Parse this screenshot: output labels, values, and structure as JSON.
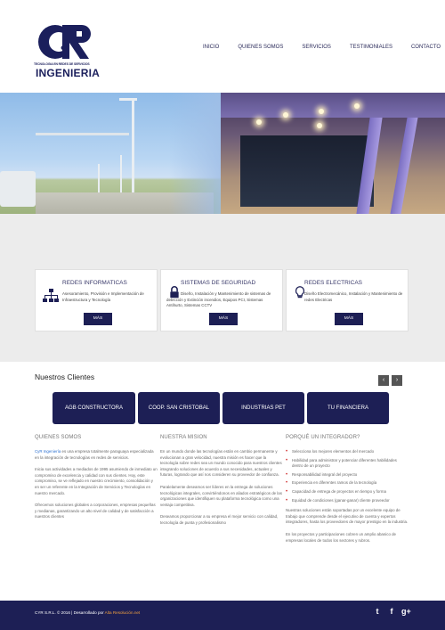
{
  "header": {
    "logo": {
      "tagline": "TECNOLOGIA EN REDES DE SERVICIOS",
      "brand": "INGENIERIA"
    },
    "nav": [
      "INICIO",
      "QUIENES SOMOS",
      "SERVICIOS",
      "TESTIMONIALES",
      "CONTACTO"
    ]
  },
  "services": [
    {
      "title": "REDES INFORMATICAS",
      "icon": "network-icon",
      "desc": "Asesoramiento, Provisión e Implementación de Infraestructura y Tecnología",
      "button": "MÁS"
    },
    {
      "title": "SISTEMAS DE SEGURIDAD",
      "icon": "lock-icon",
      "desc": "Diseño, Instalación y Mantenimiento de sistemas de detección y Extinción incendios, Equipos PCI, Sistemas Antihurto, Sistemas CCTV",
      "button": "MÁS"
    },
    {
      "title": "REDES ELECTRICAS",
      "icon": "lightbulb-icon",
      "desc": "Diseño Electromecánico, Instalación y Mantenimiento de redes Electricas",
      "button": "MÁS"
    }
  ],
  "clients": {
    "title": "Nuestros Clientes",
    "prev": "‹",
    "next": "›",
    "items": [
      "AGB CONSTRUCTORA",
      "COOP. SAN CRISTOBAL",
      "INDUSTRIAS PET",
      "TU FINANCIERA"
    ]
  },
  "about": {
    "title": "QUIENES SOMOS",
    "link_text": "CyR Ingeniería",
    "p1_rest": " es una empresa totalmente paraguaya especializada en la integración de tecnologías en redes de servicios.",
    "p2": "Inicia sus actividades a mediados de 1995 asumiendo de inmediato un compromiso de excelencia y calidad con sus clientes. Hoy, este compromiso, se ve reflejado en nuestro crecimiento, consolidación y en ser un referente en la Integración de Servicios y Tecnologías en nuestro mercado.",
    "p3": "Ofrecemos soluciones globales a corporaciones, empresas pequeñas y medianas, garantizando un alto nivel de calidad y de satisfacción a nuestros clientes"
  },
  "mission": {
    "title": "NUESTRA MISION",
    "p1": "En un mundo donde las tecnologías están en cambio permanente y evolucionan a gran velocidad, nuestra misión es hacer que la tecnología sobre redes sea un mundo conocido para nuestros clientes integrando soluciones de acuerdo a sus necesidades, actuales y futuras, logrando que así nos consideren su proveedor de confianza.",
    "p2": "Paralelamente deseamos ser líderes en la entrega de soluciones tecnológicas integrales, convirtiéndonos en aliados estratégicos de las organizaciones que identifiquen su plataforma tecnológica como una ventaja competitiva.",
    "p3": "Deseamos proporcionar a su empresa el mejor servicio con calidad, tecnología de punta y profesionalismo"
  },
  "why": {
    "title": "PORQUÉ UN INTEGRADOR?",
    "items": [
      "Selecciona los mejores elementos del mercado",
      "Habilidad para administrar y potenciar diferentes habilidades dentro de un proyecto",
      "Responsabilidad integral del proyecto",
      "Experiencia en diferentes ramos de la tecnología",
      "Capacidad de entrega de proyectos en tiempo y forma",
      "Equidad de condiciones (ganar-ganar) cliente proveedor"
    ],
    "p1": "Nuestras soluciones están soportadas por un excelente equipo de trabajo que comprende desde el ejecutivo de cuenta y expertos integradores, hasta los proveedores de mayor prestigio en la industria.",
    "p2": "En los proyectos y participaciones cobren un amplio abanico de empresas locales de todos los sectores y rubros."
  },
  "footer": {
    "copy": "CYR S.R.L. © 2016 | Desarrollado por ",
    "dev_link": "Alta Resolución.net",
    "social": [
      {
        "name": "twitter-icon",
        "glyph": "t"
      },
      {
        "name": "facebook-icon",
        "glyph": "f"
      },
      {
        "name": "google-plus-icon",
        "glyph": "g+"
      }
    ]
  },
  "colors": {
    "navy": "#1d1f55",
    "accent_link": "#2a6fd0",
    "bullet": "#d03030"
  }
}
